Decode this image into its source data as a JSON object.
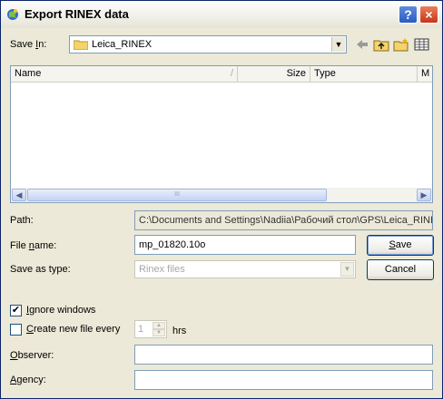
{
  "window": {
    "title": "Export RINEX data",
    "help_icon": "?",
    "close_icon": "×"
  },
  "save_in": {
    "label_pre": "Save ",
    "label_key": "I",
    "label_post": "n:",
    "value": "Leica_RINEX",
    "toolbar_icons": [
      "back-arrow-icon",
      "up-folder-icon",
      "new-folder-icon",
      "view-menu-icon"
    ]
  },
  "file_list": {
    "columns": [
      "Name",
      "Size",
      "Type",
      "M"
    ],
    "rows": [],
    "thumb_grip": "III"
  },
  "path": {
    "label": "Path:",
    "value": "C:\\Documents and Settings\\Nadiia\\Рабочий стол\\GPS\\Leica_RINEX"
  },
  "file_name": {
    "label_pre": "File ",
    "label_key": "n",
    "label_post": "ame:",
    "value": "mp_01820.10o"
  },
  "save_as_type": {
    "label": "Save as type:",
    "value": "Rinex files"
  },
  "buttons": {
    "save_key": "S",
    "save_rest": "ave",
    "cancel": "Cancel"
  },
  "options": {
    "ignore_windows_key": "I",
    "ignore_windows_rest": "gnore windows",
    "ignore_windows_checked": true,
    "create_new_key": "C",
    "create_new_rest": "reate new file every",
    "create_new_checked": false,
    "interval_value": "1",
    "interval_unit": "hrs"
  },
  "observer": {
    "label_key": "O",
    "label_rest": "bserver:",
    "value": ""
  },
  "agency": {
    "label_key": "A",
    "label_rest": "gency:",
    "value": ""
  }
}
